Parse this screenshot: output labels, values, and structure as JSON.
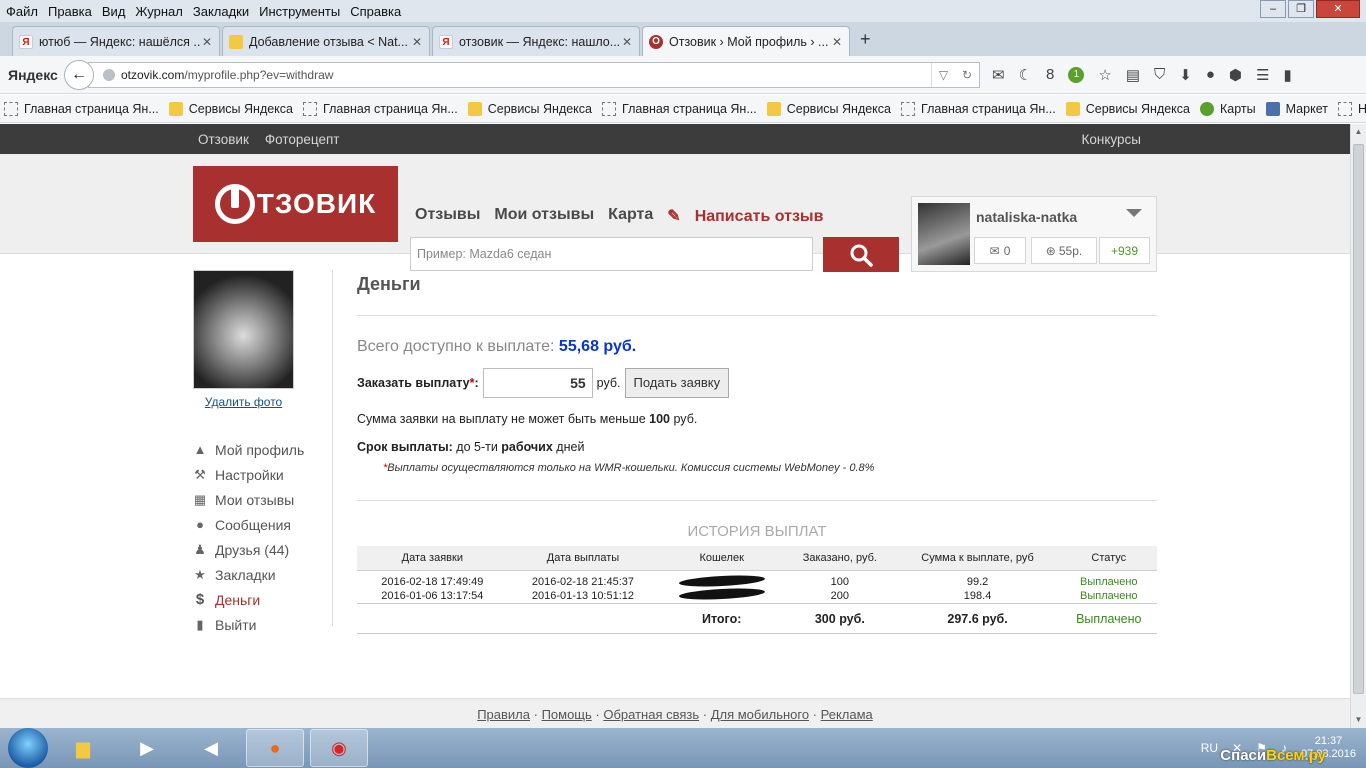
{
  "browser": {
    "menu": [
      "Файл",
      "Правка",
      "Вид",
      "Журнал",
      "Закладки",
      "Инструменты",
      "Справка"
    ],
    "tabs": [
      {
        "title": "ютюб — Яндекс: нашёлся ...",
        "icon": "yandex-icon"
      },
      {
        "title": "Добавление отзыва < Nat...",
        "icon": "page-icon"
      },
      {
        "title": "отзовик — Яндекс: нашло...",
        "icon": "yandex-icon"
      },
      {
        "title": "Отзовик › Мой профиль › ...",
        "icon": "otzovik-icon",
        "active": true
      }
    ],
    "yandex_logo": "Яндекс",
    "url_host": "otzovik.com",
    "url_path": "/myprofile.php?ev=withdraw",
    "counter_8": "8",
    "badge_1": "1",
    "bookmarks": [
      {
        "label": "Главная страница Ян...",
        "icon": "dashed"
      },
      {
        "label": "Сервисы Яндекса",
        "icon": "folder"
      },
      {
        "label": "Главная страница Ян...",
        "icon": "dashed"
      },
      {
        "label": "Сервисы Яндекса",
        "icon": "folder"
      },
      {
        "label": "Главная страница Ян...",
        "icon": "dashed"
      },
      {
        "label": "Сервисы Яндекса",
        "icon": "folder"
      },
      {
        "label": "Главная страница Ян...",
        "icon": "dashed"
      },
      {
        "label": "Сервисы Яндекса",
        "icon": "folder"
      },
      {
        "label": "Карты",
        "icon": "green"
      },
      {
        "label": "Маркет",
        "icon": "blue"
      },
      {
        "label": "Новости",
        "icon": "dashed"
      }
    ]
  },
  "site": {
    "topnav": {
      "left1": "Отзовик",
      "left2": "Фоторецепт",
      "right": "Конкурсы"
    },
    "logo_text": "ТЗОВИК",
    "nav": {
      "reviews": "Отзывы",
      "my_reviews": "Мои отзывы",
      "map": "Карта",
      "write": "Написать отзыв"
    },
    "search_placeholder": "Пример: Mazda6 седан",
    "user": {
      "name": "nataliska-natka",
      "messages": "0",
      "money": "55р.",
      "score": "+939"
    },
    "sidebar": {
      "delete_photo": "Удалить фото",
      "items": [
        {
          "label": "Мой профиль",
          "icon": "person-icon"
        },
        {
          "label": "Настройки",
          "icon": "wrench-icon"
        },
        {
          "label": "Мои отзывы",
          "icon": "keyboard-icon"
        },
        {
          "label": "Сообщения",
          "icon": "chat-icon"
        },
        {
          "label": "Друзья (44)",
          "icon": "friends-icon"
        },
        {
          "label": "Закладки",
          "icon": "star-icon"
        },
        {
          "label": "Деньги",
          "icon": "dollar-icon",
          "active": true
        },
        {
          "label": "Выйти",
          "icon": "exit-icon"
        }
      ]
    },
    "money": {
      "title": "Деньги",
      "available_label": "Всего доступно к выплате:",
      "available_value": "55,68 руб.",
      "order_label": "Заказать выплату",
      "order_star": "*",
      "order_colon": ":",
      "order_value": "55",
      "order_unit": "руб.",
      "submit": "Подать заявку",
      "min_note_pre": "Сумма заявки на выплату не может быть меньше ",
      "min_note_amount": "100",
      "min_note_post": " руб.",
      "term_label": "Срок выплаты:",
      "term_text_pre": " до 5-ти ",
      "term_bold": "рабочих",
      "term_text_post": " дней",
      "footnote_star": "*",
      "footnote": "Выплаты осуществляются только на WMR-кошельки. Комиссия системы WebMoney - 0.8%",
      "history_title": "ИСТОРИЯ ВЫПЛАТ",
      "columns": [
        "Дата заявки",
        "Дата выплаты",
        "Кошелек",
        "Заказано, руб.",
        "Сумма к выплате, руб",
        "Статус"
      ],
      "rows": [
        {
          "requested": "2016-02-18 17:49:49",
          "paid": "2016-02-18 21:45:37",
          "wallet": "",
          "ordered": "100",
          "payout": "99.2",
          "status": "Выплачено"
        },
        {
          "requested": "2016-01-06 13:17:54",
          "paid": "2016-01-13 10:51:12",
          "wallet": "",
          "ordered": "200",
          "payout": "198.4",
          "status": "Выплачено"
        }
      ],
      "total_label": "Итого:",
      "total_ordered": "300 руб.",
      "total_payout": "297.6 руб.",
      "total_status": "Выплачено"
    },
    "footer": [
      "Правила",
      "Помощь",
      "Обратная связь",
      "Для мобильного",
      "Реклама"
    ]
  },
  "taskbar": {
    "lang": "RU",
    "time": "21:37",
    "date": "07.03.2016",
    "watermark_a": "Спаси",
    "watermark_b": "Всем.ру"
  },
  "colors": {
    "brand": "#a8302e",
    "link": "#1b4e8c",
    "amount": "#0a35c8",
    "status_ok": "#3a8a1a"
  }
}
